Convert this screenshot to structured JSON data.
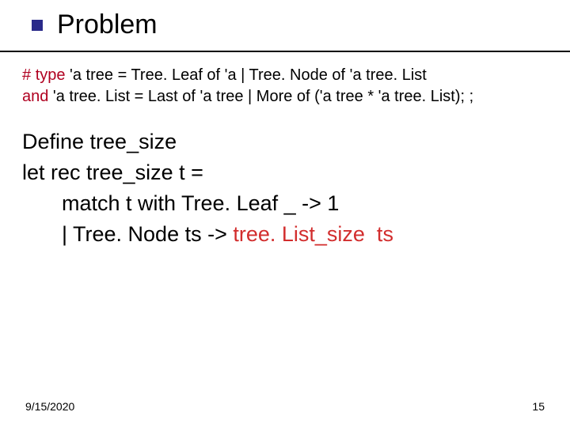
{
  "title": "Problem",
  "typedef": {
    "hash": "#",
    "kw_type": "type",
    "line1_rest": " 'a tree = Tree. Leaf of 'a | Tree. Node of 'a tree. List",
    "kw_and": "and",
    "line2_rest": " 'a tree. List = Last of 'a tree | More of ('a tree * 'a tree. List); ;"
  },
  "body": {
    "l1": "Define tree_size",
    "l2": "let rec tree_size t =",
    "l3": "match t with Tree. Leaf _ -> 1",
    "l4_prefix": "| Tree. Node ts -> ",
    "l4_red": "tree. List_size  ts"
  },
  "footer": {
    "date": "9/15/2020",
    "page": "15"
  }
}
